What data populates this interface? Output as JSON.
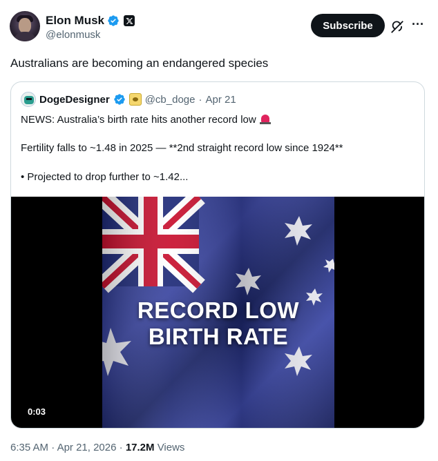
{
  "author": {
    "display_name": "Elon Musk",
    "handle": "@elonmusk",
    "verified": true,
    "affiliate_badge": "x-logo-icon"
  },
  "actions": {
    "subscribe_label": "Subscribe",
    "grok_icon": "grok-icon",
    "more_icon": "more-icon",
    "more_glyph": "···"
  },
  "tweet_text": "Australians are becoming an endangered species",
  "quoted": {
    "display_name": "DogeDesigner",
    "verified": true,
    "handle": "@cb_doge",
    "separator": "·",
    "date": "Apr 21",
    "lines": [
      "NEWS: Australia’s birth rate hits another record low",
      "Fertility falls to ~1.48 in 2025 — **2nd straight record low since 1924**",
      "• Projected to drop further to ~1.42..."
    ],
    "video": {
      "caption_line1": "RECORD LOW",
      "caption_line2": "BIRTH RATE",
      "timecode": "0:03"
    }
  },
  "meta": {
    "time": "6:35 AM",
    "separator": "·",
    "date": "Apr 21, 2026",
    "views_count": "17.2M",
    "views_label": "Views"
  },
  "colors": {
    "text_primary": "#0f1419",
    "text_secondary": "#536471",
    "verified_blue": "#1d9bf0",
    "border": "#cfd9de",
    "flag_blue": "#1e2a78",
    "flag_red": "#c8102e"
  }
}
